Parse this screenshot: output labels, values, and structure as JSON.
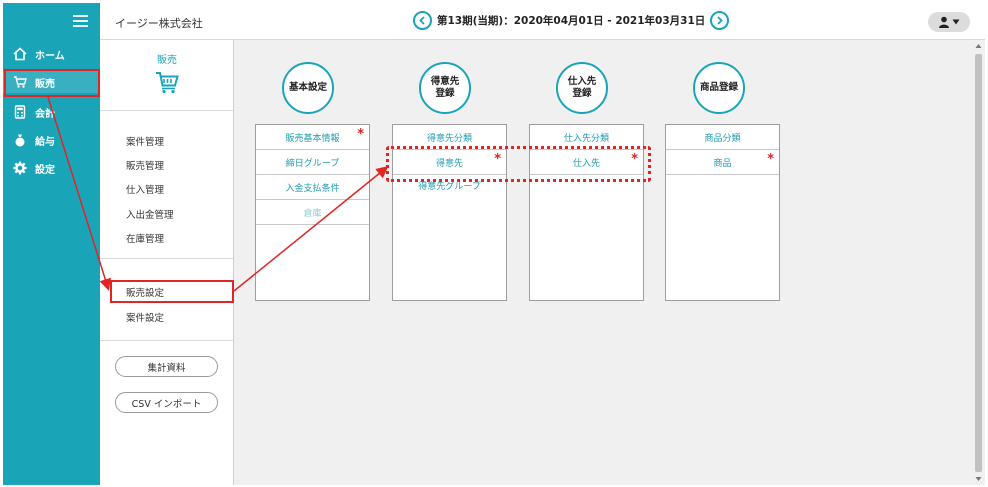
{
  "sidebar": {
    "items": [
      {
        "label": "ホーム",
        "icon": "home-icon"
      },
      {
        "label": "販売",
        "icon": "cart-icon"
      },
      {
        "label": "会計",
        "icon": "calculator-icon"
      },
      {
        "label": "給与",
        "icon": "money-bag-icon"
      },
      {
        "label": "設定",
        "icon": "gear-icon"
      }
    ]
  },
  "header": {
    "company": "イージー株式会社",
    "period": "第13期(当期)：2020年04月01日 - 2021年03月31日"
  },
  "submenu": {
    "title": "販売",
    "group1": [
      "案件管理",
      "販売管理",
      "仕入管理",
      "入出金管理",
      "在庫管理"
    ],
    "group2": [
      "販売設定",
      "案件設定"
    ],
    "buttons": [
      "集計資料",
      "CSV インポート"
    ]
  },
  "categories": [
    {
      "title": "基本設定",
      "items": [
        {
          "label": "販売基本情報",
          "required": true
        },
        {
          "label": "締日グループ",
          "required": false
        },
        {
          "label": "入金支払条件",
          "required": false
        },
        {
          "label": "倉庫",
          "required": false,
          "dim": true
        }
      ]
    },
    {
      "title": "得意先\n登録",
      "items": [
        {
          "label": "得意先分類",
          "required": false
        },
        {
          "label": "得意先",
          "required": true
        },
        {
          "label": "得意先グループ",
          "required": false
        }
      ]
    },
    {
      "title": "仕入先\n登録",
      "items": [
        {
          "label": "仕入先分類",
          "required": false
        },
        {
          "label": "仕入先",
          "required": true
        }
      ]
    },
    {
      "title": "商品登録",
      "items": [
        {
          "label": "商品分類",
          "required": false
        },
        {
          "label": "商品",
          "required": true
        }
      ]
    }
  ],
  "required_mark": "*",
  "colors": {
    "accent": "#1aa4b8",
    "highlight": "#e12424",
    "content_bg": "#f0f0f0"
  }
}
